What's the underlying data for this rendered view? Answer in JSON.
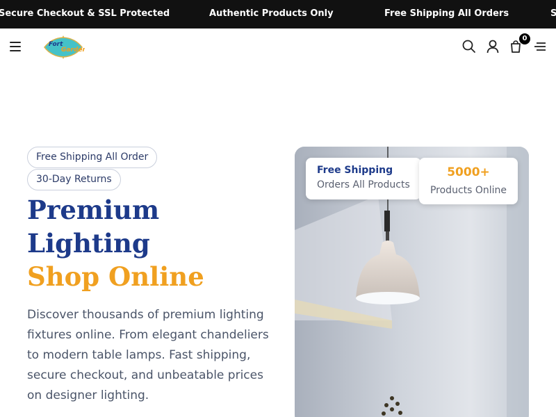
{
  "announcement_bar": {
    "items": [
      "Secure Checkout & SSL Protected",
      "Authentic Products Only",
      "Free Shipping All Orders",
      "S"
    ]
  },
  "header": {
    "logo_text": "FortGarden",
    "cart_count": "0",
    "icons": [
      "menu-icon",
      "search-icon",
      "user-icon",
      "cart-icon",
      "filter-icon"
    ]
  },
  "hero": {
    "badges": [
      "Free Shipping All Order",
      "30-Day Returns"
    ],
    "title_line1": "Premium",
    "title_line2": "Lighting",
    "title_line3": "Shop Online",
    "description": "Discover thousands of premium lighting fixtures online. From elegant chandeliers to modern table lamps. Fast shipping, secure checkout, and unbeatable prices on designer lighting.",
    "stat_card_1": {
      "title": "Free Shipping",
      "subtitle": "Orders All Products"
    },
    "stat_card_2": {
      "title": "5000+",
      "subtitle": "Products Online"
    }
  },
  "colors": {
    "announcement_bg": "#111111",
    "heading_blue": "#1d3a8a",
    "accent_orange": "#f0a020",
    "body_text": "#4a5468"
  }
}
